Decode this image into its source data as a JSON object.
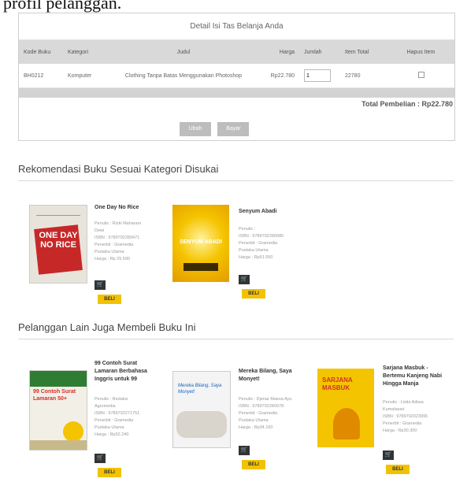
{
  "caption": "profil pelanggan.",
  "cart": {
    "title": "Detail Isi Tas Belanja Anda",
    "headers": [
      "Kode Buku",
      "Kategori",
      "Judul",
      "Harga",
      "Jumlah",
      "Item Total",
      "Hapus Item"
    ],
    "row": {
      "code": "BH0212",
      "category": "Komputer",
      "title": "Clothing Tanpa Batas Menggunakan Photoshop",
      "price": "Rp22.780",
      "qty": "1",
      "item_total": "22780"
    },
    "total_label": "Total Pembelian : Rp22.780",
    "buttons": [
      "Ubah",
      "Bayar"
    ]
  },
  "sections": {
    "recommend_title": "Rekomendasi Buku Sesuai Kategori Disukai",
    "others_title": "Pelanggan Lain Juga Membeli Buku Ini"
  },
  "beli_label": "BELI",
  "cart_icon_glyph": "🛒",
  "recommend": [
    {
      "title": "One Day No Rice",
      "details": [
        "Penulis : Rizki Maharani",
        "Dewi",
        "ISBN : 9789792289471",
        "Penerbit : Gramedia",
        "Pustaka Utama",
        "Harga : Rp 29.590"
      ],
      "cover_text": "ONE DAY NO RICE",
      "cover_color": "#e8e4dc",
      "cover_accent": "#c62828"
    },
    {
      "title": "Senyum Abadi",
      "details": [
        "Penulis :",
        "ISBN : 9789792280980",
        "Penerbit : Gramedia",
        "Pustaka Utama",
        "Harga : Rp51.550"
      ],
      "cover_text": "SENYUM ABADI",
      "cover_color": "#f5c400",
      "cover_accent": "#e39b00"
    }
  ],
  "others": [
    {
      "title": "99 Contoh Surat Lamaran Berbahasa Inggris untuk 99",
      "details": [
        "Penulis : Redaksi",
        "Agromedia",
        "ISBN : 9789792271751",
        "Penerbit : Gramedia",
        "Pustaka Utama",
        "Harga : Rp52.240"
      ],
      "cover_text": "99 Contoh Surat Lamaran 50+",
      "cover_color": "#f2f0e6",
      "cover_accent": "#2e7d32"
    },
    {
      "title": "Mereka Bilang, Saya Monyet!",
      "details": [
        "Penulis : Djenar Maesa Ayu",
        "ISBN : 9789792280978",
        "Penerbit : Gramedia",
        "Pustaka Utama",
        "Harga : Rp34.160"
      ],
      "cover_text": "Mereka Bilang, Saya Monyet!",
      "cover_color": "#f4f4f4",
      "cover_accent": "#1565c0"
    },
    {
      "title": "Sarjana Masbuk - Bertemu Kanjeng Nabi Hingga Manja",
      "details": [
        "Penulis : Listia Adiwa",
        "Kumalasari",
        "ISBN : 9789792023995",
        "Penerbit : Gramedia",
        "Harga : Rp30.300"
      ],
      "cover_text": "SARJANA MASBUK",
      "cover_color": "#f4c400",
      "cover_accent": "#d32f2f"
    }
  ]
}
